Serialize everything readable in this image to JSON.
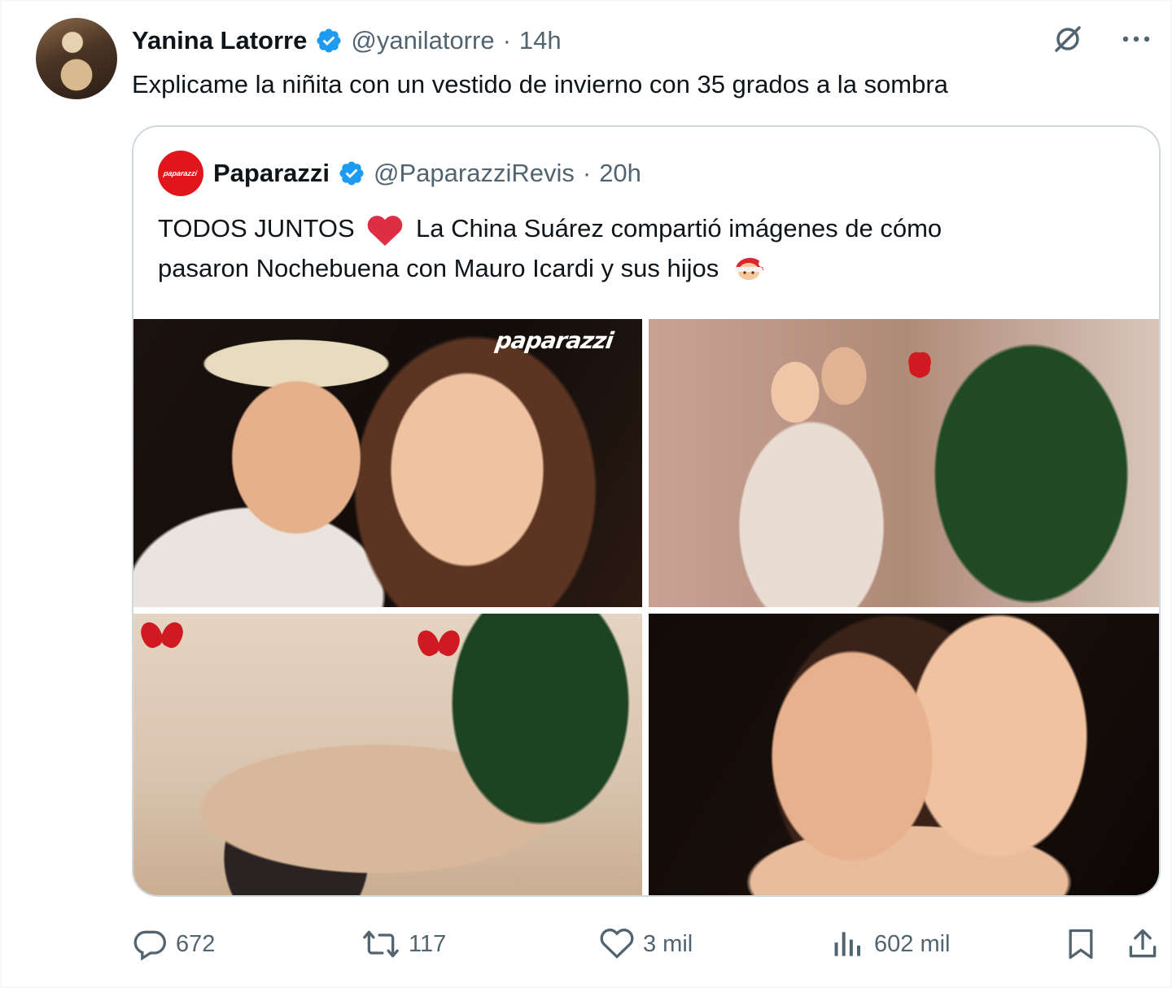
{
  "tweet": {
    "author_name": "Yanina Latorre",
    "handle": "@yanilatorre",
    "separator": "·",
    "time": "14h",
    "text": "Explicame la niñita con un vestido de invierno con 35 grados a la sombra"
  },
  "quote": {
    "author_name": "Paparazzi",
    "avatar_label": "paparazzi",
    "handle": "@PaparazziRevis",
    "separator": "·",
    "time": "20h",
    "text_line1_a": "TODOS JUNTOS",
    "text_line1_b": "La China Suárez compartió imágenes de cómo",
    "text_line2": "pasaron Nochebuena con Mauro Icardi y sus hijos",
    "photo_watermark": "paparazzi"
  },
  "stats": {
    "replies": "672",
    "reposts": "117",
    "likes": "3 mil",
    "views": "602 mil"
  },
  "icons": [
    "verified-badge-icon",
    "grok-icon",
    "more-icon",
    "heart-emoji",
    "santa-emoji",
    "reply-icon",
    "repost-icon",
    "like-icon",
    "views-icon",
    "bookmark-icon",
    "share-icon"
  ],
  "colors": {
    "verified": "#1d9bf0",
    "paparazzi_brand": "#e1161c",
    "secondary_text": "#536471",
    "border": "#cfd9de"
  }
}
